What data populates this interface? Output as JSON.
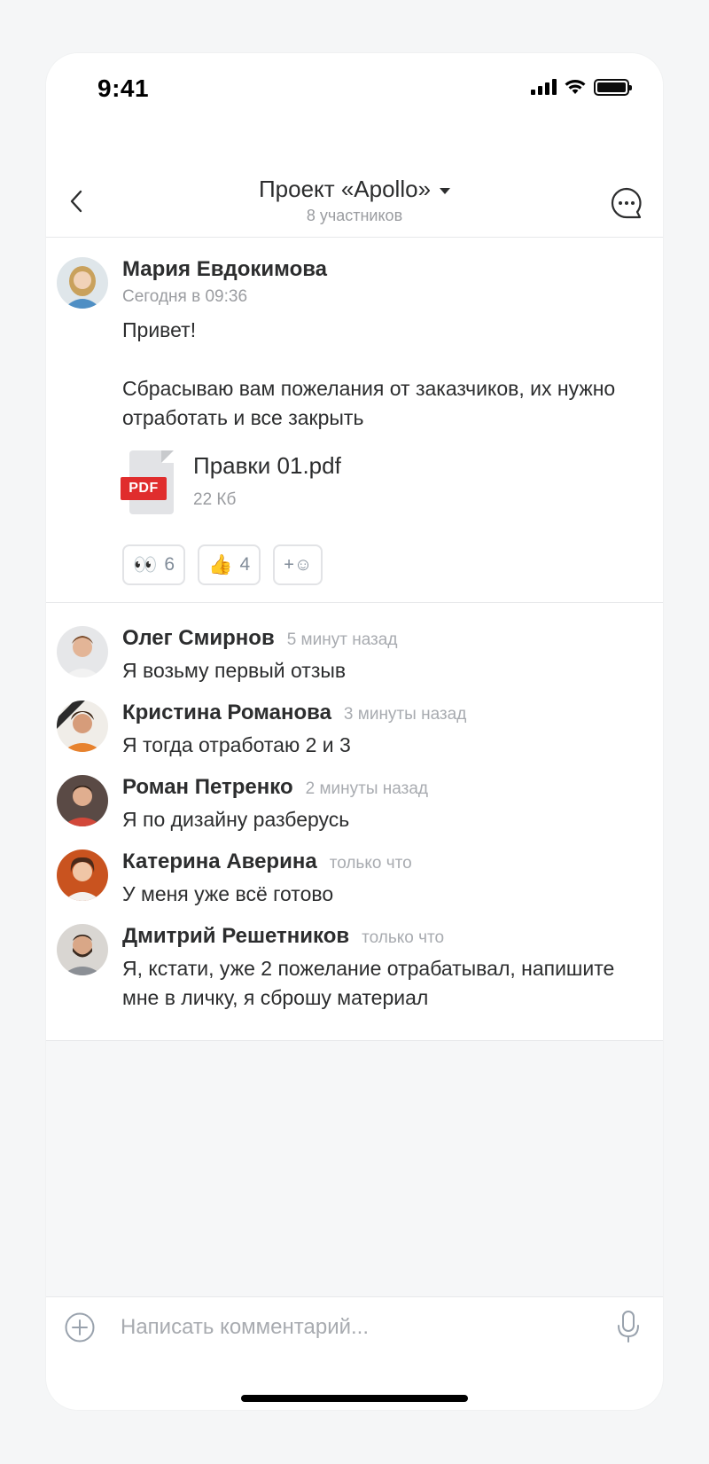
{
  "status_bar": {
    "time": "9:41"
  },
  "header": {
    "title": "Проект «Apollo»",
    "subtitle": "8 участников"
  },
  "post": {
    "author": "Мария Евдокимова",
    "date": "Сегодня в 09:36",
    "text": "Привет!\n\nСбрасываю вам пожелания от заказчиков, их нужно отработать и все закрыть",
    "attachment": {
      "badge": "PDF",
      "name": "Правки 01.pdf",
      "size": "22 Кб"
    },
    "reactions": [
      {
        "emoji": "👀",
        "count": "6"
      },
      {
        "emoji": "👍",
        "count": "4"
      },
      {
        "emoji": "+☺",
        "count": ""
      }
    ]
  },
  "comments": [
    {
      "name": "Олег Смирнов",
      "time": "5 минут назад",
      "text": "Я возьму первый отзыв"
    },
    {
      "name": "Кристина Романова",
      "time": "3 минуты назад",
      "text": "Я тогда отработаю 2 и 3"
    },
    {
      "name": "Роман Петренко",
      "time": "2 минуты назад",
      "text": "Я по дизайну разберусь"
    },
    {
      "name": "Катерина Аверина",
      "time": "только что",
      "text": "У меня уже всё готово"
    },
    {
      "name": "Дмитрий Решетников",
      "time": "только что",
      "text": "Я, кстати, уже 2 пожелание отрабатывал, напишите мне в личку, я сброшу материал"
    }
  ],
  "composer": {
    "placeholder": "Написать комментарий..."
  }
}
